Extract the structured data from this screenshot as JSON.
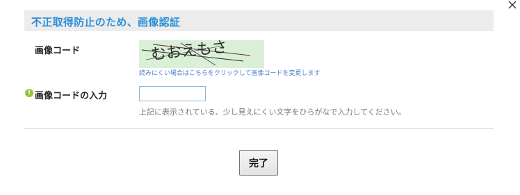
{
  "dialog": {
    "title": "不正取得防止のため、画像認証",
    "close_icon": "close-icon"
  },
  "captcha": {
    "label": "画像コード",
    "image_text": "むおえもさ",
    "hint": "読みにくい場合はこちらをクリックして画像コードを変更します",
    "background_color": "#d9efd6"
  },
  "code_entry": {
    "required_icon": "exclamation-circle-icon",
    "required_mark": "!",
    "label": "画像コードの入力",
    "value": "",
    "placeholder": "",
    "hint": "上記に表示されている、少し見えにくい文字をひらがなで入力してください。"
  },
  "actions": {
    "submit_label": "完了"
  },
  "colors": {
    "accent": "#2e8fd8",
    "header_bg": "#ececec",
    "required": "#9bc23c",
    "link": "#4a7fc9"
  }
}
